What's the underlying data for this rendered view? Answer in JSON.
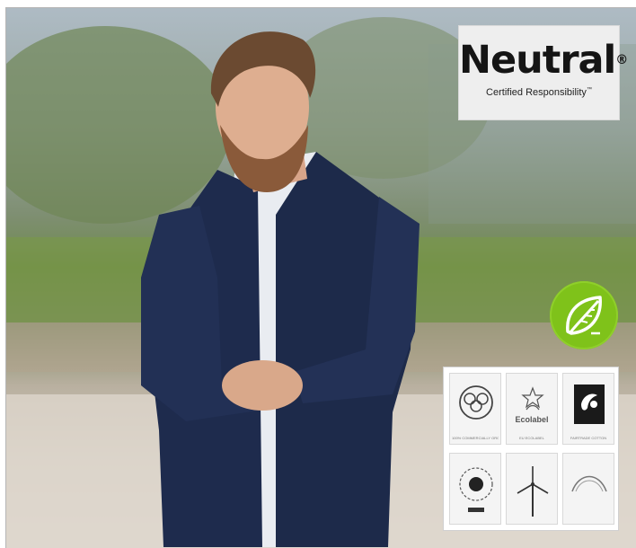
{
  "brand": {
    "name": "Neutral",
    "registered_mark": "®",
    "tagline": "Certified Responsibility",
    "tagline_mark": "™"
  },
  "icons": {
    "eco": "leaf-icon"
  },
  "certifications": [
    {
      "icon": "cotton-icon",
      "caption": "100% COMMERCIALLY ORGANIC COTTON"
    },
    {
      "icon": "ecolabel-icon",
      "brand": "Ecolabel",
      "caption": "EU ECOLABEL"
    },
    {
      "icon": "fairtrade-icon",
      "caption": "FAIRTRADE COTTON"
    },
    {
      "icon": "gear-sun-icon",
      "caption": ""
    },
    {
      "icon": "wind-turbine-icon",
      "caption": ""
    },
    {
      "icon": "arc-icon",
      "caption": ""
    }
  ],
  "colors": {
    "leaf_green": "#7fc21a",
    "jacket_navy": "#1d2a4a",
    "badge_bg": "#eeeeee"
  }
}
